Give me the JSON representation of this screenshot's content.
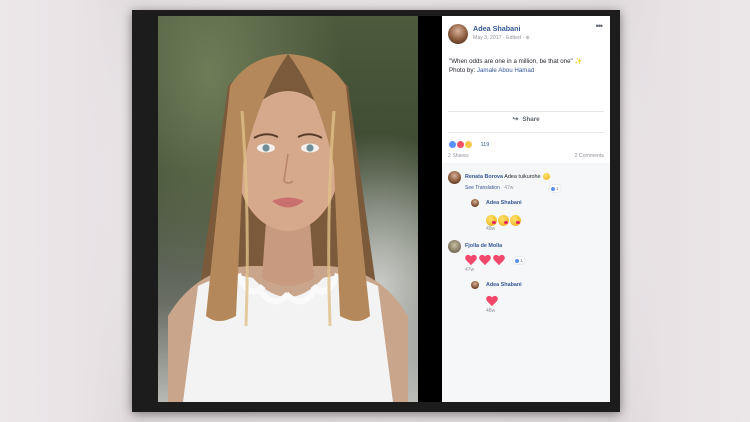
{
  "post": {
    "author": "Adea Shabani",
    "date": "May 3, 2017 · Edited · ",
    "more": "•••",
    "text_quote": "\"When odds are one in a million, be that one\"",
    "text_photo_by": "Photo by: ",
    "photographer": "Jamale Abou Hamad",
    "share_label": "Share",
    "reaction_count": "119",
    "shares": "2 Shares",
    "comments_count": "2 Comments"
  },
  "comments": [
    {
      "name": "Renata Borova",
      "text": " Adea tuikurohe",
      "see_translation": "See Translation",
      "time": " · 47w",
      "like_count": "1"
    },
    {
      "name": "Adea Shabani",
      "time": "48w",
      "emoji": [
        "kissing-face",
        "kissing-face",
        "kissing-face"
      ]
    },
    {
      "name": "Fjolla de Molla",
      "time": "47w",
      "emoji": [
        "heart",
        "heart",
        "heart"
      ],
      "like_count": "1"
    },
    {
      "name": "Adea Shabani",
      "time": "48w",
      "emoji": [
        "heart"
      ]
    }
  ],
  "colors": {
    "link_blue": "#365899",
    "meta_gray": "#90949c",
    "heart_red": "#f0476b"
  }
}
